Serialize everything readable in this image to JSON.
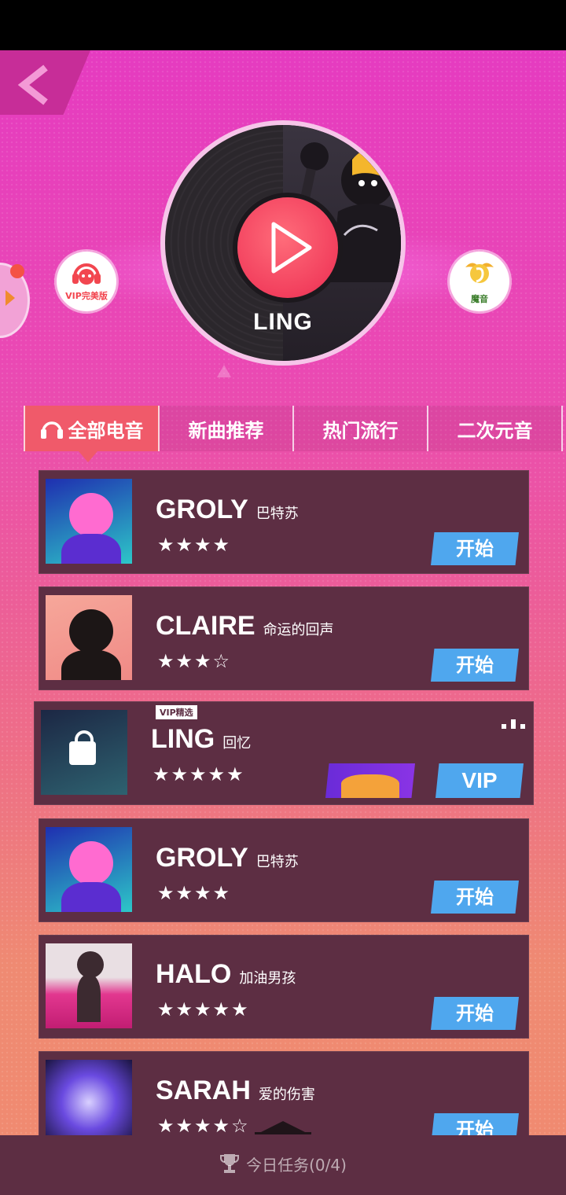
{
  "header": {
    "back_icon": "chevron-left-icon",
    "now_playing_title": "LING",
    "left_button_label": "VIP完美版",
    "right_button_label": "魔音"
  },
  "tabs": [
    {
      "label": "全部电音",
      "active": true
    },
    {
      "label": "新曲推荐",
      "active": false
    },
    {
      "label": "热门流行",
      "active": false
    },
    {
      "label": "二次元音",
      "active": false
    }
  ],
  "songs": [
    {
      "artist": "GROLY",
      "title": "巴特苏",
      "stars": "★★★★",
      "action": "开始"
    },
    {
      "artist": "CLAIRE",
      "title": "命运的回声",
      "stars": "★★★☆",
      "action": "开始"
    },
    {
      "artist": "LING",
      "title": "回忆",
      "stars": "★★★★★",
      "action": "VIP",
      "badge": "VIP精选"
    },
    {
      "artist": "GROLY",
      "title": "巴特苏",
      "stars": "★★★★",
      "action": "开始"
    },
    {
      "artist": "HALO",
      "title": "加油男孩",
      "stars": "★★★★★",
      "action": "开始"
    },
    {
      "artist": "SARAH",
      "title": "爱的伤害",
      "stars": "★★★★☆",
      "action": "开始"
    }
  ],
  "footer": {
    "task_label": "今日任务(0/4)"
  },
  "colors": {
    "accent_pink": "#e53bc0",
    "row_bg": "#5d2e43",
    "start_blue": "#4fa7ee",
    "active_tab": "#f05a6a"
  }
}
